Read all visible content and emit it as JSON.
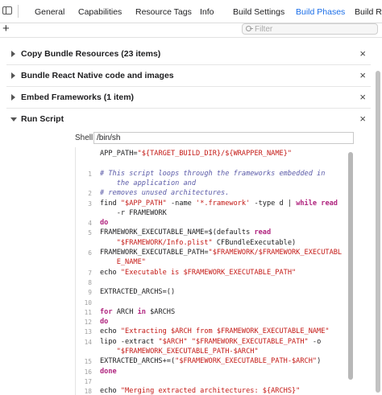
{
  "tabs": [
    {
      "label": "General",
      "active": false
    },
    {
      "label": "Capabilities",
      "active": false
    },
    {
      "label": "Resource Tags",
      "active": false
    },
    {
      "label": "Info",
      "active": false
    },
    {
      "label": "Build Settings",
      "active": false
    },
    {
      "label": "Build Phases",
      "active": true
    },
    {
      "label": "Build Rul",
      "active": false
    }
  ],
  "toolbar": {
    "add_label": "+",
    "filter_placeholder": "Filter"
  },
  "phases": [
    {
      "title": "Copy Bundle Resources (23 items)",
      "expanded": false,
      "close": "×"
    },
    {
      "title": "Bundle React Native code and images",
      "expanded": false,
      "close": "×"
    },
    {
      "title": "Embed Frameworks (1 item)",
      "expanded": false,
      "close": "×"
    },
    {
      "title": "Run Script",
      "expanded": true,
      "close": "×"
    }
  ],
  "run_script": {
    "shell_label": "Shell",
    "shell_value": "/bin/sh",
    "lines": [
      {
        "num": "",
        "tokens": [
          {
            "t": "APP_PATH=",
            "c": ""
          },
          {
            "t": "\"${TARGET_BUILD_DIR}/${WRAPPER_NAME}\"",
            "c": "str"
          }
        ]
      },
      {
        "num": "",
        "tokens": []
      },
      {
        "num": "1",
        "tokens": [
          {
            "t": "# This script loops through the frameworks embedded in",
            "c": "cm"
          }
        ]
      },
      {
        "num": "",
        "tokens": [
          {
            "t": "    the application and",
            "c": "cm"
          }
        ]
      },
      {
        "num": "2",
        "tokens": [
          {
            "t": "# removes unused architectures.",
            "c": "cm"
          }
        ]
      },
      {
        "num": "3",
        "tokens": [
          {
            "t": "find ",
            "c": ""
          },
          {
            "t": "\"$APP_PATH\"",
            "c": "str"
          },
          {
            "t": " -name ",
            "c": ""
          },
          {
            "t": "'*.framework'",
            "c": "str"
          },
          {
            "t": " -type d | ",
            "c": ""
          },
          {
            "t": "while",
            "c": "kw"
          },
          {
            "t": " ",
            "c": ""
          },
          {
            "t": "read",
            "c": "kw"
          }
        ]
      },
      {
        "num": "",
        "tokens": [
          {
            "t": "    -r FRAMEWORK",
            "c": ""
          }
        ]
      },
      {
        "num": "4",
        "tokens": [
          {
            "t": "do",
            "c": "kw"
          }
        ]
      },
      {
        "num": "5",
        "tokens": [
          {
            "t": "FRAMEWORK_EXECUTABLE_NAME=$(defaults ",
            "c": ""
          },
          {
            "t": "read",
            "c": "kw"
          }
        ]
      },
      {
        "num": "",
        "tokens": [
          {
            "t": "    ",
            "c": ""
          },
          {
            "t": "\"$FRAMEWORK/Info.plist\"",
            "c": "str"
          },
          {
            "t": " CFBundleExecutable)",
            "c": ""
          }
        ]
      },
      {
        "num": "6",
        "tokens": [
          {
            "t": "FRAMEWORK_EXECUTABLE_PATH=",
            "c": ""
          },
          {
            "t": "\"$FRAMEWORK/$FRAMEWORK_EXECUTABL",
            "c": "str"
          }
        ]
      },
      {
        "num": "",
        "tokens": [
          {
            "t": "    E_NAME\"",
            "c": "str"
          }
        ]
      },
      {
        "num": "7",
        "tokens": [
          {
            "t": "echo ",
            "c": ""
          },
          {
            "t": "\"Executable is $FRAMEWORK_EXECUTABLE_PATH\"",
            "c": "str"
          }
        ]
      },
      {
        "num": "8",
        "tokens": []
      },
      {
        "num": "9",
        "tokens": [
          {
            "t": "EXTRACTED_ARCHS=()",
            "c": ""
          }
        ]
      },
      {
        "num": "10",
        "tokens": []
      },
      {
        "num": "11",
        "tokens": [
          {
            "t": "for",
            "c": "kw"
          },
          {
            "t": " ARCH ",
            "c": ""
          },
          {
            "t": "in",
            "c": "kw"
          },
          {
            "t": " $ARCHS",
            "c": ""
          }
        ]
      },
      {
        "num": "12",
        "tokens": [
          {
            "t": "do",
            "c": "kw"
          }
        ]
      },
      {
        "num": "13",
        "tokens": [
          {
            "t": "echo ",
            "c": ""
          },
          {
            "t": "\"Extracting $ARCH from $FRAMEWORK_EXECUTABLE_NAME\"",
            "c": "str"
          }
        ]
      },
      {
        "num": "14",
        "tokens": [
          {
            "t": "lipo -extract ",
            "c": ""
          },
          {
            "t": "\"$ARCH\"",
            "c": "str"
          },
          {
            "t": " ",
            "c": ""
          },
          {
            "t": "\"$FRAMEWORK_EXECUTABLE_PATH\"",
            "c": "str"
          },
          {
            "t": " -o",
            "c": ""
          }
        ]
      },
      {
        "num": "",
        "tokens": [
          {
            "t": "    ",
            "c": ""
          },
          {
            "t": "\"$FRAMEWORK_EXECUTABLE_PATH-$ARCH\"",
            "c": "str"
          }
        ]
      },
      {
        "num": "15",
        "tokens": [
          {
            "t": "EXTRACTED_ARCHS+=(",
            "c": ""
          },
          {
            "t": "\"$FRAMEWORK_EXECUTABLE_PATH-$ARCH\"",
            "c": "str"
          },
          {
            "t": ")",
            "c": ""
          }
        ]
      },
      {
        "num": "16",
        "tokens": [
          {
            "t": "done",
            "c": "kw"
          }
        ]
      },
      {
        "num": "17",
        "tokens": []
      },
      {
        "num": "18",
        "tokens": [
          {
            "t": "echo ",
            "c": ""
          },
          {
            "t": "\"Merging extracted architectures: ${ARCHS}\"",
            "c": "str"
          }
        ]
      }
    ]
  }
}
